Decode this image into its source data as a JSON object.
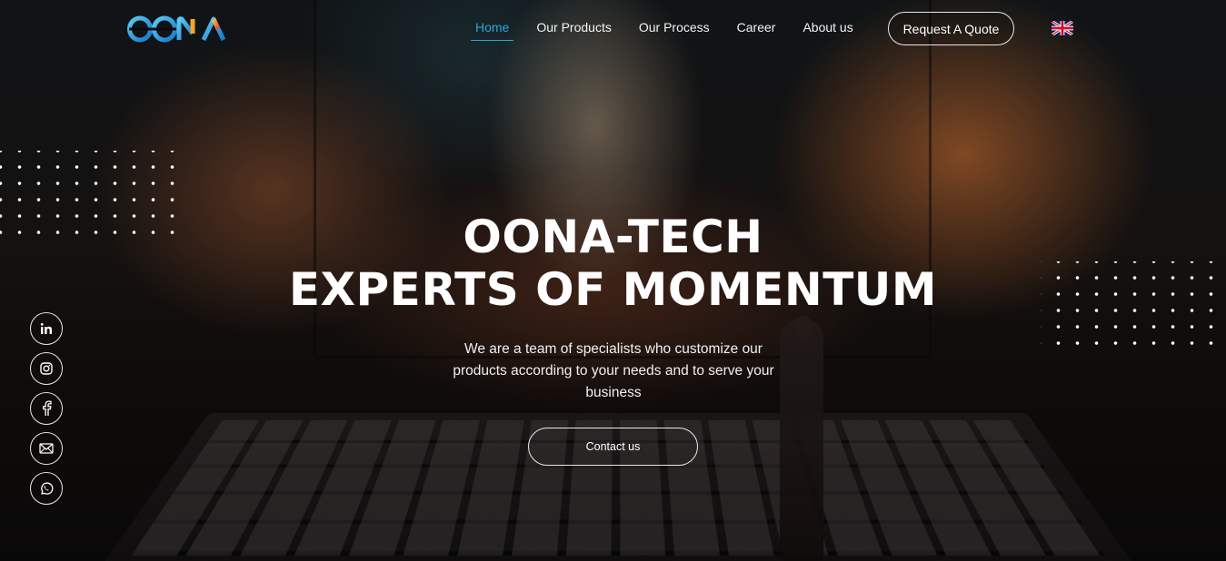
{
  "brand": {
    "logo_text": "OONA"
  },
  "nav": {
    "items": [
      {
        "label": "Home",
        "active": true
      },
      {
        "label": "Our Products",
        "active": false
      },
      {
        "label": "Our Process",
        "active": false
      },
      {
        "label": "Career",
        "active": false
      },
      {
        "label": "About us",
        "active": false
      }
    ],
    "quote_button": "Request A Quote",
    "language_icon": "uk-flag-icon"
  },
  "hero": {
    "title_line1": "OONA-TECH",
    "title_line2": "EXPERTS OF MOMENTUM",
    "subtitle": "We are a team of specialists who customize our products according to your needs and to serve your business",
    "cta_label": "Contact us"
  },
  "social": [
    {
      "icon": "linkedin-icon"
    },
    {
      "icon": "instagram-icon"
    },
    {
      "icon": "facebook-icon"
    },
    {
      "icon": "mail-icon"
    },
    {
      "icon": "whatsapp-icon"
    }
  ],
  "colors": {
    "accent": "#2ba6d6",
    "text": "#ffffff",
    "background": "#0b0b0d",
    "logo_blue": "#2aa8e0",
    "logo_orange": "#f5a623",
    "logo_red": "#e84a3a"
  }
}
